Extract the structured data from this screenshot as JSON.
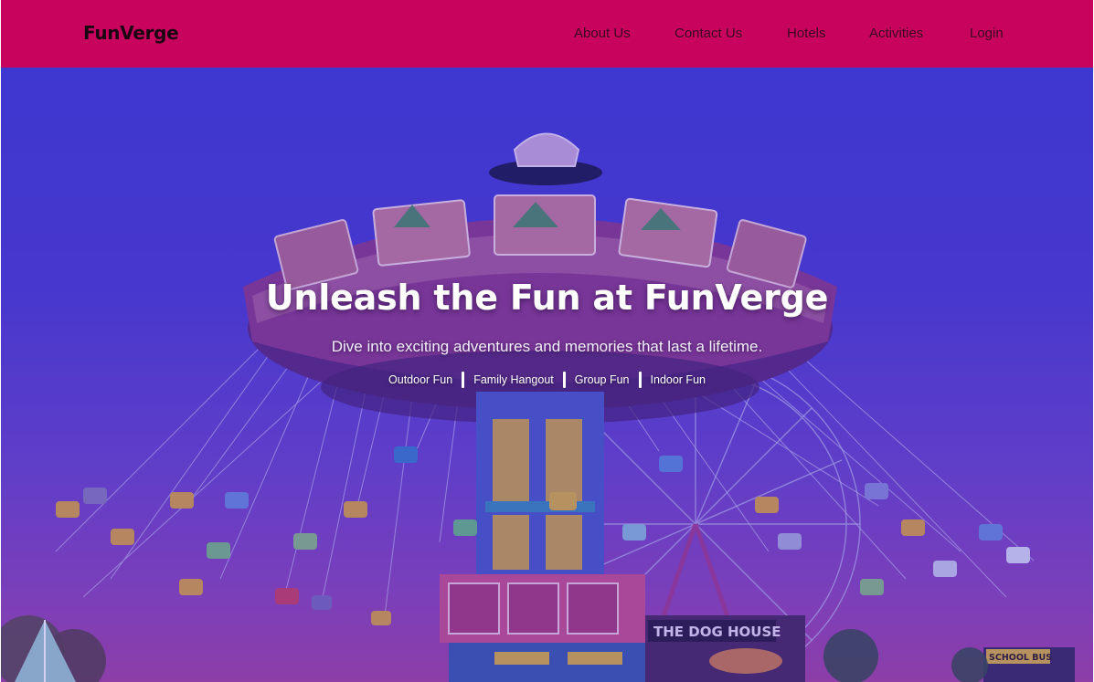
{
  "brand": {
    "name": "FunVerge"
  },
  "nav": {
    "items": [
      "About Us",
      "Contact Us",
      "Hotels",
      "Activities",
      "Login"
    ]
  },
  "hero": {
    "title": "Unleash the Fun at FunVerge",
    "subtitle": "Dive into exciting adventures and memories that last a lifetime.",
    "tags": [
      "Outdoor Fun",
      "Family Hangout",
      "Group Fun",
      "Indoor Fun"
    ]
  },
  "scene": {
    "signs": [
      "THE DOG HOUSE",
      "SCHOOL BUS"
    ]
  },
  "colors": {
    "navbar": "#c8035d",
    "brand_text": "#1a0612",
    "nav_text": "#3a0a22",
    "hero_overlay_top": "#3f3cd0",
    "hero_overlay_bottom": "#a4459c"
  }
}
